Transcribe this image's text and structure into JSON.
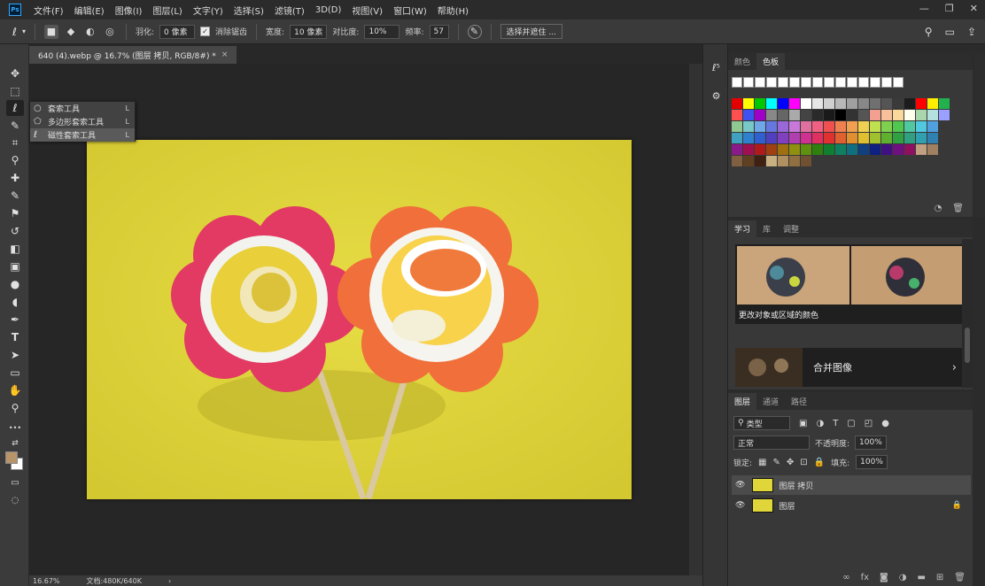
{
  "app": {
    "logo_text": "Ps",
    "menu": [
      "文件(F)",
      "编辑(E)",
      "图像(I)",
      "图层(L)",
      "文字(Y)",
      "选择(S)",
      "滤镜(T)",
      "3D(D)",
      "视图(V)",
      "窗口(W)",
      "帮助(H)"
    ],
    "window_controls": [
      "—",
      "❐",
      "✕"
    ]
  },
  "options_bar": {
    "tool_icon": "magnetic-lasso-icon",
    "feather_label": "羽化:",
    "feather_value": "0 像素",
    "antialias_label": "消除锯齿",
    "width_label": "宽度:",
    "width_value": "10 像素",
    "contrast_label": "对比度:",
    "contrast_value": "10%",
    "frequency_label": "频率:",
    "frequency_value": "57",
    "select_mask_label": "选择并遮住 ..."
  },
  "document": {
    "tab_title": "640 (4).webp @ 16.7% (图层 拷贝, RGB/8#) *",
    "zoom": "16.67%",
    "status_info": "文档:480K/640K"
  },
  "tool_flyout": {
    "items": [
      {
        "icon": "lasso-icon",
        "label": "套索工具",
        "shortcut": "L",
        "selected": false
      },
      {
        "icon": "polygonal-lasso-icon",
        "label": "多边形套索工具",
        "shortcut": "L",
        "selected": false
      },
      {
        "icon": "magnetic-lasso-icon",
        "label": "磁性套索工具",
        "shortcut": "L",
        "selected": true
      }
    ]
  },
  "tools": [
    {
      "name": "move-tool",
      "glyph": "✥"
    },
    {
      "name": "marquee-tool",
      "glyph": "⬚"
    },
    {
      "name": "lasso-tool",
      "glyph": "ℓ"
    },
    {
      "name": "quick-select-tool",
      "glyph": "✎"
    },
    {
      "name": "crop-tool",
      "glyph": "⌗"
    },
    {
      "name": "eyedropper-tool",
      "glyph": "⚲"
    },
    {
      "name": "healing-brush-tool",
      "glyph": "✚"
    },
    {
      "name": "brush-tool",
      "glyph": "✎"
    },
    {
      "name": "clone-stamp-tool",
      "glyph": "⚑"
    },
    {
      "name": "history-brush-tool",
      "glyph": "↺"
    },
    {
      "name": "eraser-tool",
      "glyph": "◧"
    },
    {
      "name": "gradient-tool",
      "glyph": "▣"
    },
    {
      "name": "blur-tool",
      "glyph": "●"
    },
    {
      "name": "dodge-tool",
      "glyph": "◖"
    },
    {
      "name": "pen-tool",
      "glyph": "✒"
    },
    {
      "name": "type-tool",
      "glyph": "T"
    },
    {
      "name": "path-select-tool",
      "glyph": "➤"
    },
    {
      "name": "rectangle-tool",
      "glyph": "▭"
    },
    {
      "name": "hand-tool",
      "glyph": "✋"
    },
    {
      "name": "zoom-tool",
      "glyph": "⚲"
    },
    {
      "name": "more-tools",
      "glyph": "•••"
    },
    {
      "name": "swap-colors",
      "glyph": "⇄"
    }
  ],
  "panels": {
    "swatches": {
      "tabs": [
        "颜色",
        "色板"
      ],
      "active_tab": "色板"
    },
    "learn": {
      "tabs": [
        "学习",
        "库",
        "调整"
      ],
      "active_tab": "学习",
      "card1_caption": "更改对象或区域的颜色",
      "card2_title": "合并图像"
    },
    "layers": {
      "tabs": [
        "图层",
        "通道",
        "路径"
      ],
      "active_tab": "图层",
      "filter_kind": "类型",
      "blend_mode": "正常",
      "opacity_label": "不透明度:",
      "opacity_value": "100%",
      "lock_label": "锁定:",
      "fill_label": "填充:",
      "fill_value": "100%",
      "rows": [
        {
          "name": "图层 拷贝",
          "selected": true,
          "locked": false
        },
        {
          "name": "图层",
          "selected": false,
          "locked": true
        }
      ]
    }
  },
  "colors": {
    "foreground": "#b8946a",
    "background": "#ffffff",
    "accent": "#31a8ff"
  }
}
